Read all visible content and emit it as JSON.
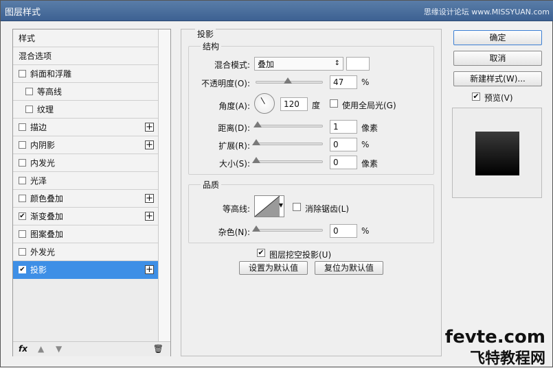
{
  "window": {
    "title": "图层样式",
    "watermark_top": "思缘设计论坛 www.MISSYUAN.com"
  },
  "left_list": {
    "items": [
      {
        "label": "样式",
        "checkbox": false,
        "checked": false,
        "indent": false,
        "plus": false,
        "selected": false,
        "kind": "header"
      },
      {
        "label": "混合选项",
        "checkbox": false,
        "checked": false,
        "indent": false,
        "plus": false,
        "selected": false,
        "kind": "header"
      },
      {
        "label": "斜面和浮雕",
        "checkbox": true,
        "checked": false,
        "indent": false,
        "plus": false,
        "selected": false
      },
      {
        "label": "等高线",
        "checkbox": true,
        "checked": false,
        "indent": true,
        "plus": false,
        "selected": false
      },
      {
        "label": "纹理",
        "checkbox": true,
        "checked": false,
        "indent": true,
        "plus": false,
        "selected": false
      },
      {
        "label": "描边",
        "checkbox": true,
        "checked": false,
        "indent": false,
        "plus": true,
        "selected": false
      },
      {
        "label": "内阴影",
        "checkbox": true,
        "checked": false,
        "indent": false,
        "plus": true,
        "selected": false
      },
      {
        "label": "内发光",
        "checkbox": true,
        "checked": false,
        "indent": false,
        "plus": false,
        "selected": false
      },
      {
        "label": "光泽",
        "checkbox": true,
        "checked": false,
        "indent": false,
        "plus": false,
        "selected": false
      },
      {
        "label": "颜色叠加",
        "checkbox": true,
        "checked": false,
        "indent": false,
        "plus": true,
        "selected": false
      },
      {
        "label": "渐变叠加",
        "checkbox": true,
        "checked": true,
        "indent": false,
        "plus": true,
        "selected": false
      },
      {
        "label": "图案叠加",
        "checkbox": true,
        "checked": false,
        "indent": false,
        "plus": false,
        "selected": false
      },
      {
        "label": "外发光",
        "checkbox": true,
        "checked": false,
        "indent": false,
        "plus": false,
        "selected": false
      },
      {
        "label": "投影",
        "checkbox": true,
        "checked": true,
        "indent": false,
        "plus": true,
        "selected": true
      }
    ],
    "footer": {
      "fx": "fx"
    }
  },
  "drop_shadow": {
    "section_title": "投影",
    "structure": {
      "title": "结构",
      "blend_mode_label": "混合模式:",
      "blend_mode_value": "叠加",
      "opacity_label": "不透明度(O):",
      "opacity_value": "47",
      "opacity_unit": "%",
      "angle_label": "角度(A):",
      "angle_value": "120",
      "angle_unit": "度",
      "global_light_label": "使用全局光(G)",
      "global_light_checked": false,
      "distance_label": "距离(D):",
      "distance_value": "1",
      "distance_unit": "像素",
      "spread_label": "扩展(R):",
      "spread_value": "0",
      "spread_unit": "%",
      "size_label": "大小(S):",
      "size_value": "0",
      "size_unit": "像素"
    },
    "quality": {
      "title": "品质",
      "contour_label": "等高线:",
      "anti_alias_label": "消除锯齿(L)",
      "anti_alias_checked": false,
      "noise_label": "杂色(N):",
      "noise_value": "0",
      "noise_unit": "%"
    },
    "knockout_label": "图层挖空投影(U)",
    "knockout_checked": true,
    "make_default_label": "设置为默认值",
    "reset_default_label": "复位为默认值"
  },
  "right_panel": {
    "ok_label": "确定",
    "cancel_label": "取消",
    "new_style_label": "新建样式(W)...",
    "preview_label": "预览(V)",
    "preview_checked": true
  },
  "watermark_bottom": {
    "line1": "fevte.com",
    "line2": "飞特教程网"
  },
  "colors": {
    "title_bar": "#3d6192",
    "selected_row": "#3e8fe6"
  }
}
